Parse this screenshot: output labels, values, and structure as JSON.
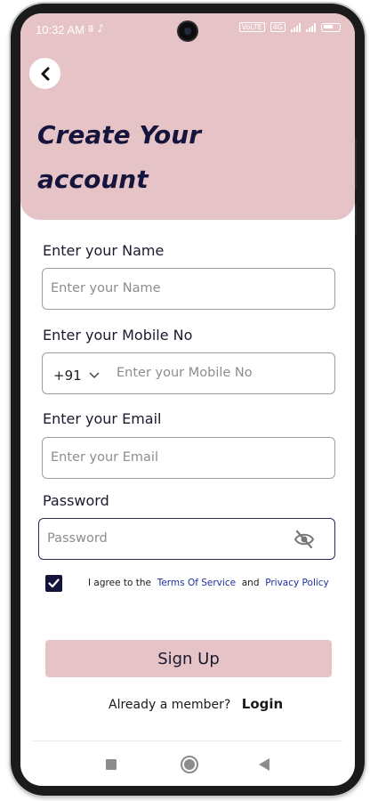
{
  "status_bar": {
    "time": "10:32 AM",
    "left_icons": "⩩ ♪",
    "badge_left": "4G",
    "badge_vo": "VoLTE"
  },
  "header": {
    "title_line1": "Create Your",
    "title_line2": "account",
    "background_color": "#e6c3c6"
  },
  "form": {
    "name": {
      "label": "Enter your Name",
      "placeholder": "Enter your Name",
      "value": ""
    },
    "mobile": {
      "label": "Enter your Mobile No",
      "country_code": "+91",
      "placeholder": "Enter your Mobile No",
      "value": ""
    },
    "email": {
      "label": "Enter your Email",
      "placeholder": "Enter your Email",
      "value": ""
    },
    "password": {
      "label": "Password",
      "placeholder": "Password",
      "value": ""
    },
    "agree": {
      "checked": true,
      "prefix": "I agree to the",
      "terms": "Terms Of Service",
      "and": "and",
      "privacy": "Privacy Policy"
    },
    "submit_label": "Sign Up"
  },
  "footer": {
    "member_text": "Already a member?",
    "login_label": "Login"
  },
  "colors": {
    "accent": "#e6c3c6",
    "title": "#14143c",
    "link": "#1e2fa0"
  }
}
